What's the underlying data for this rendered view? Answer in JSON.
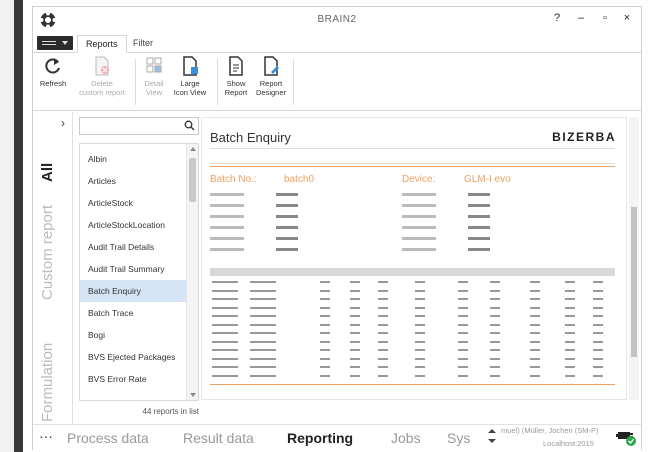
{
  "window": {
    "title": "BRAIN2",
    "help": "?",
    "minimize": "–",
    "maximize": "▫",
    "close": "×"
  },
  "ribbon_tabs": [
    {
      "label": "Reports"
    },
    {
      "label": "Filter"
    }
  ],
  "ribbon": {
    "refresh": "Refresh",
    "delete_line1": "Delete",
    "delete_line2": "custom report",
    "detail_line1": "Detail",
    "detail_line2": "View",
    "large_line1": "Large",
    "large_line2": "Icon View",
    "show_line1": "Show",
    "show_line2": "Report",
    "designer_line1": "Report",
    "designer_line2": "Designer"
  },
  "vtabs": [
    {
      "label": "All"
    },
    {
      "label": "Custom report"
    },
    {
      "label": "Formulation"
    }
  ],
  "search": {
    "value": "",
    "placeholder": ""
  },
  "reports": [
    {
      "label": "Albin"
    },
    {
      "label": "Articles"
    },
    {
      "label": "ArticleStock"
    },
    {
      "label": "ArticleStockLocation"
    },
    {
      "label": "Audit Trail Details"
    },
    {
      "label": "Audit Trail Summary"
    },
    {
      "label": "Batch Enquiry"
    },
    {
      "label": "Batch Trace"
    },
    {
      "label": "Bogi"
    },
    {
      "label": "BVS Ejected Packages"
    },
    {
      "label": "BVS Error Rate"
    }
  ],
  "selected_report": "Batch Enquiry",
  "report_count": "44 reports in list",
  "preview": {
    "title": "Batch Enquiry",
    "brand": "BIZERBA",
    "batch_label": "Batch No.:",
    "batch_value": "batch0",
    "device_label": "Device:",
    "device_value": "GLM-I evo"
  },
  "bottom_nav": {
    "more": "···",
    "items": [
      {
        "label": "Process data"
      },
      {
        "label": "Result data"
      },
      {
        "label": "Reporting"
      },
      {
        "label": "Jobs"
      },
      {
        "label": "Sys"
      }
    ],
    "user": "muel) (Müller, Jochen (SM-P)",
    "host": "Localhost:2015"
  },
  "colors": {
    "accent_orange": "#f0a060",
    "selection_blue": "#d4e4f4",
    "status_green": "#2aa84a"
  }
}
